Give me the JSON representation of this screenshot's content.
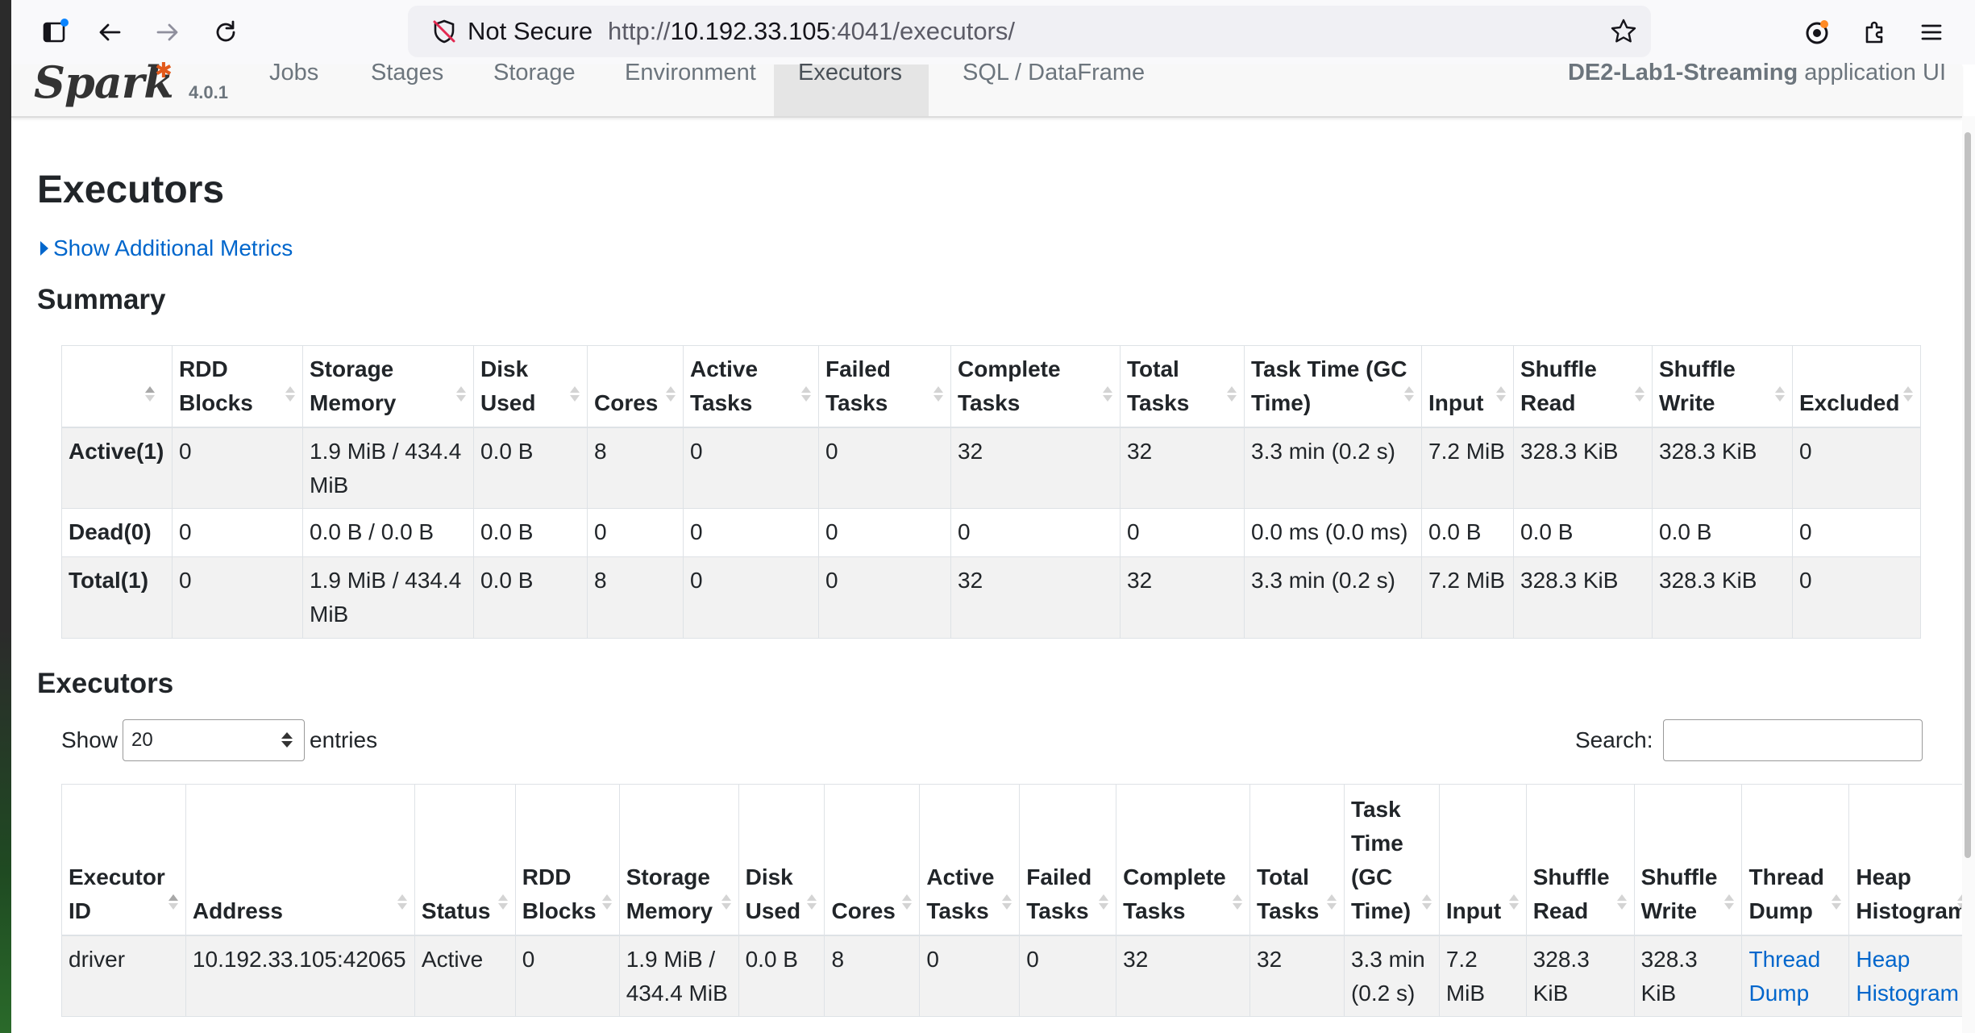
{
  "browser": {
    "not_secure": "Not Secure",
    "url_prefix": "http://",
    "url_host": "10.192.33.105",
    "url_rest": ":4041/executors/"
  },
  "spark": {
    "brand": "Spark",
    "version": "4.0.1",
    "nav": [
      "Jobs",
      "Stages",
      "Storage",
      "Environment",
      "Executors",
      "SQL / DataFrame"
    ],
    "active_tab": "Executors",
    "app_name": "DE2-Lab1-Streaming",
    "app_suffix": "application UI"
  },
  "page": {
    "title": "Executors",
    "additional_metrics": "Show Additional Metrics"
  },
  "summary": {
    "heading": "Summary",
    "headers": [
      "RDD Blocks",
      "Storage Memory",
      "Disk Used",
      "Cores",
      "Active Tasks",
      "Failed Tasks",
      "Complete Tasks",
      "Total Tasks",
      "Task Time (GC Time)",
      "Input",
      "Shuffle Read",
      "Shuffle Write",
      "Excluded"
    ],
    "rows": [
      {
        "label": "Active(1)",
        "cells": [
          "0",
          "1.9 MiB / 434.4 MiB",
          "0.0 B",
          "8",
          "0",
          "0",
          "32",
          "32",
          "3.3 min (0.2 s)",
          "7.2 MiB",
          "328.3 KiB",
          "328.3 KiB",
          "0"
        ]
      },
      {
        "label": "Dead(0)",
        "cells": [
          "0",
          "0.0 B / 0.0 B",
          "0.0 B",
          "0",
          "0",
          "0",
          "0",
          "0",
          "0.0 ms (0.0 ms)",
          "0.0 B",
          "0.0 B",
          "0.0 B",
          "0"
        ]
      },
      {
        "label": "Total(1)",
        "cells": [
          "0",
          "1.9 MiB / 434.4 MiB",
          "0.0 B",
          "8",
          "0",
          "0",
          "32",
          "32",
          "3.3 min (0.2 s)",
          "7.2 MiB",
          "328.3 KiB",
          "328.3 KiB",
          "0"
        ]
      }
    ]
  },
  "executors": {
    "heading": "Executors",
    "show_label": "Show",
    "entries_value": "20",
    "entries_label": "entries",
    "search_label": "Search:",
    "headers": [
      "Executor ID",
      "Address",
      "Status",
      "RDD Blocks",
      "Storage Memory",
      "Disk Used",
      "Cores",
      "Active Tasks",
      "Failed Tasks",
      "Complete Tasks",
      "Total Tasks",
      "Task Time (GC Time)",
      "Input",
      "Shuffle Read",
      "Shuffle Write",
      "Thread Dump",
      "Heap Histogram"
    ],
    "rows": [
      {
        "executor_id": "driver",
        "address": "10.192.33.105:42065",
        "status": "Active",
        "rdd_blocks": "0",
        "storage_memory": "1.9 MiB / 434.4 MiB",
        "disk_used": "0.0 B",
        "cores": "8",
        "active_tasks": "0",
        "failed_tasks": "0",
        "complete_tasks": "32",
        "total_tasks": "32",
        "task_time": "3.3 min (0.2 s)",
        "input": "7.2 MiB",
        "shuffle_read": "328.3 KiB",
        "shuffle_write": "328.3 KiB",
        "thread_dump": "Thread Dump",
        "heap_histogram": "Heap Histogram"
      }
    ]
  }
}
